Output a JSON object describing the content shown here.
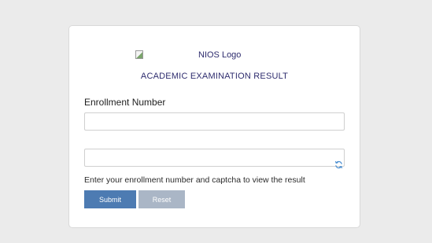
{
  "header": {
    "logo_alt": "NIOS Logo",
    "title": "ACADEMIC EXAMINATION RESULT"
  },
  "form": {
    "enrollment_label": "Enrollment Number",
    "enrollment_value": "",
    "captcha_value": "",
    "refresh_icon": "refresh-icon",
    "help_text": "Enter your enrollment number and captcha to view the result",
    "submit_label": "Submit",
    "reset_label": "Reset"
  },
  "colors": {
    "background": "#ebebeb",
    "title_color": "#2e2c6e",
    "submit_bg": "#4d7bb2",
    "reset_bg": "#aab6c6",
    "refresh_icon": "#4b8fd1"
  }
}
